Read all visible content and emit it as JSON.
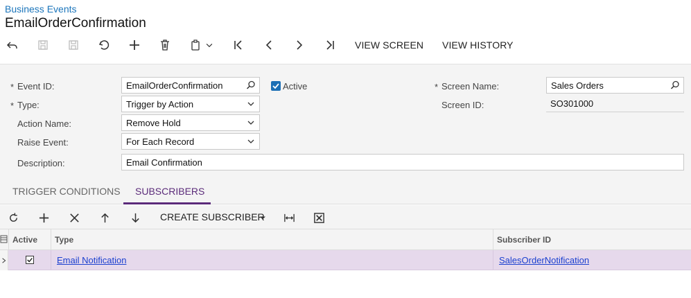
{
  "header": {
    "breadcrumb": "Business Events",
    "title": "EmailOrderConfirmation"
  },
  "toolbar": {
    "view_screen": "VIEW SCREEN",
    "view_history": "VIEW HISTORY"
  },
  "form": {
    "event_id": {
      "label": "Event ID:",
      "value": "EmailOrderConfirmation"
    },
    "active": {
      "label": "Active",
      "checked": true
    },
    "type": {
      "label": "Type:",
      "value": "Trigger by Action"
    },
    "action_name": {
      "label": "Action Name:",
      "value": "Remove Hold"
    },
    "raise_event": {
      "label": "Raise Event:",
      "value": "For Each Record"
    },
    "description": {
      "label": "Description:",
      "value": "Email Confirmation"
    },
    "screen_name": {
      "label": "Screen Name:",
      "value": "Sales Orders"
    },
    "screen_id": {
      "label": "Screen ID:",
      "value": "SO301000"
    },
    "required_marker": "*"
  },
  "tabs": [
    {
      "label": "TRIGGER CONDITIONS",
      "active": false
    },
    {
      "label": "SUBSCRIBERS",
      "active": true
    }
  ],
  "grid_toolbar": {
    "create_subscriber": "CREATE SUBSCRIBER"
  },
  "grid": {
    "columns": [
      "Active",
      "Type",
      "Subscriber ID"
    ],
    "rows": [
      {
        "active": true,
        "type": "Email Notification",
        "subscriber_id": "SalesOrderNotification"
      }
    ]
  },
  "colors": {
    "accent": "#5b2b7a",
    "link": "#1a3fcf",
    "breadcrumb": "#1b75bb",
    "selected_row": "#e6d9ec"
  }
}
